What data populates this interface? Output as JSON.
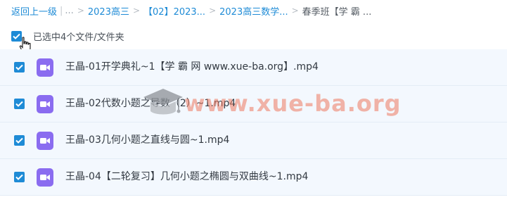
{
  "breadcrumb": {
    "back_label": "返回上一级",
    "ellipsis": "...",
    "items": [
      "2023高三",
      "【02】2023...",
      "2023高三数学...",
      "春季班【学 霸 ..."
    ]
  },
  "selection": {
    "label": "已选中4个文件/文件夹"
  },
  "files": [
    {
      "name": "王晶-01开学典礼~1【学 霸 网 www.xue-ba.org】.mp4"
    },
    {
      "name": "王晶-02代数小题之导数（2）~1.mp4"
    },
    {
      "name": "王晶-03几何小题之直线与圆~1.mp4"
    },
    {
      "name": "王晶-04【二轮复习】几何小题之椭圆与双曲线~1.mp4"
    }
  ],
  "watermark": {
    "text": "www.xue-ba.org"
  },
  "colors": {
    "accent": "#1e8bd6",
    "row_bg": "#f3f8fe",
    "video_icon": "#8a6cf0"
  },
  "icons": {
    "checkbox": "check-icon",
    "file": "video-file-icon",
    "cursor": "hand-pointer-icon"
  }
}
